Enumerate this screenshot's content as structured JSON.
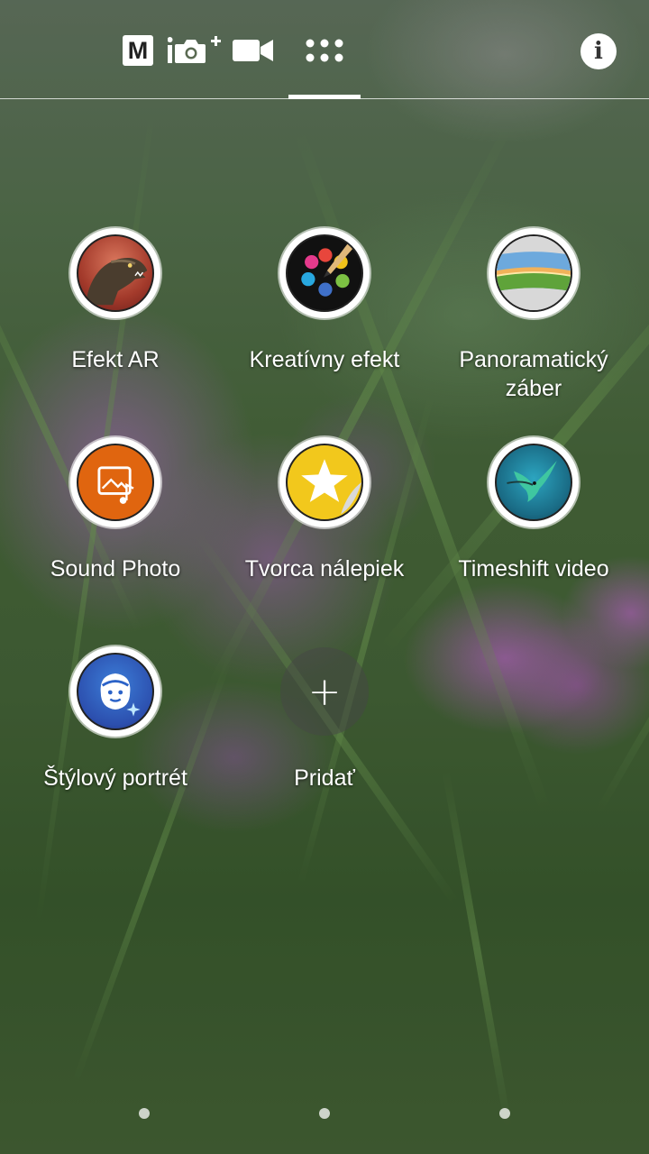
{
  "topbar": {
    "modes": [
      {
        "name": "manual",
        "label": "M"
      },
      {
        "name": "intelligent-photo",
        "icon": "camera-plus-icon"
      },
      {
        "name": "video",
        "icon": "video-camera-icon"
      },
      {
        "name": "camera-apps",
        "icon": "apps-grid-icon",
        "active": true
      }
    ],
    "info_label": "i"
  },
  "apps": [
    {
      "label": "Efekt AR",
      "icon": "dinosaur-icon"
    },
    {
      "label": "Kreatívny efekt",
      "icon": "palette-icon"
    },
    {
      "label": "Panoramatický\nzáber",
      "icon": "panorama-icon"
    },
    {
      "label": "Sound Photo",
      "icon": "sound-photo-icon"
    },
    {
      "label": "Tvorca nálepiek",
      "icon": "sticker-star-icon"
    },
    {
      "label": "Timeshift video",
      "icon": "hummingbird-icon"
    },
    {
      "label": "Štýlový portrét",
      "icon": "style-portrait-icon"
    }
  ],
  "add": {
    "symbol": "+",
    "label": "Pridať"
  },
  "colors": {
    "accent": "#ffffff",
    "sound_photo": "#e0650f",
    "sticker_yellow": "#f2c81c",
    "portrait_blue": "#2c63c8"
  }
}
